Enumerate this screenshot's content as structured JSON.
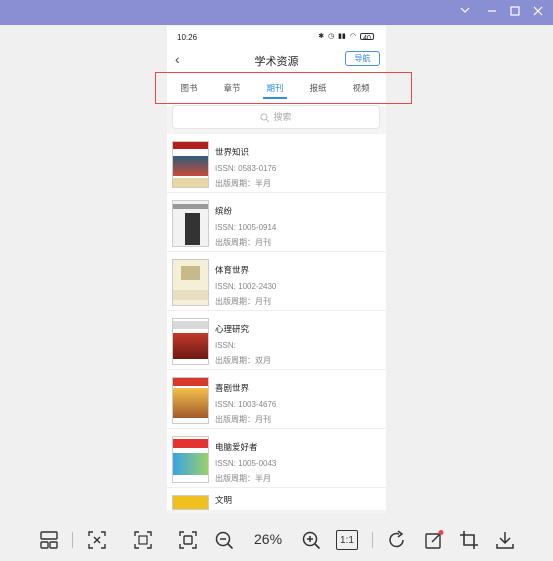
{
  "window": {
    "controls": [
      "chevron-down-icon",
      "minimize-icon",
      "maximize-icon",
      "close-icon"
    ]
  },
  "phone": {
    "status_time": "10:26",
    "battery_label": "40",
    "title": "学术资源",
    "back_symbol": "‹",
    "guide_button": "导航",
    "tabs": [
      {
        "label": "图书",
        "active": false
      },
      {
        "label": "章节",
        "active": false
      },
      {
        "label": "期刊",
        "active": true
      },
      {
        "label": "报纸",
        "active": false
      },
      {
        "label": "视频",
        "active": false
      }
    ],
    "search_placeholder": "搜索",
    "journals": [
      {
        "title": "世界知识",
        "issn": "ISSN: 0583-0176",
        "period": "出版周期：半月"
      },
      {
        "title": "缤纷",
        "issn": "ISSN: 1005-0914",
        "period": "出版周期：月刊"
      },
      {
        "title": "体育世界",
        "issn": "ISSN: 1002-2430",
        "period": "出版周期：月刊"
      },
      {
        "title": "心理研究",
        "issn": "ISSN:",
        "period": "出版周期：双月"
      },
      {
        "title": "喜剧世界",
        "issn": "ISSN: 1003-4676",
        "period": "出版周期：月刊"
      },
      {
        "title": "电脑爱好者",
        "issn": "ISSN: 1005-0043",
        "period": "出版周期：半月"
      },
      {
        "title": "文明",
        "issn": "",
        "period": ""
      }
    ]
  },
  "toolbar": {
    "zoom": "26%",
    "actual_size": "1:1",
    "colors": {
      "accent": "#2f8ee8",
      "highlight": "#e5484d",
      "titlebar": "#8a8fd3"
    }
  }
}
